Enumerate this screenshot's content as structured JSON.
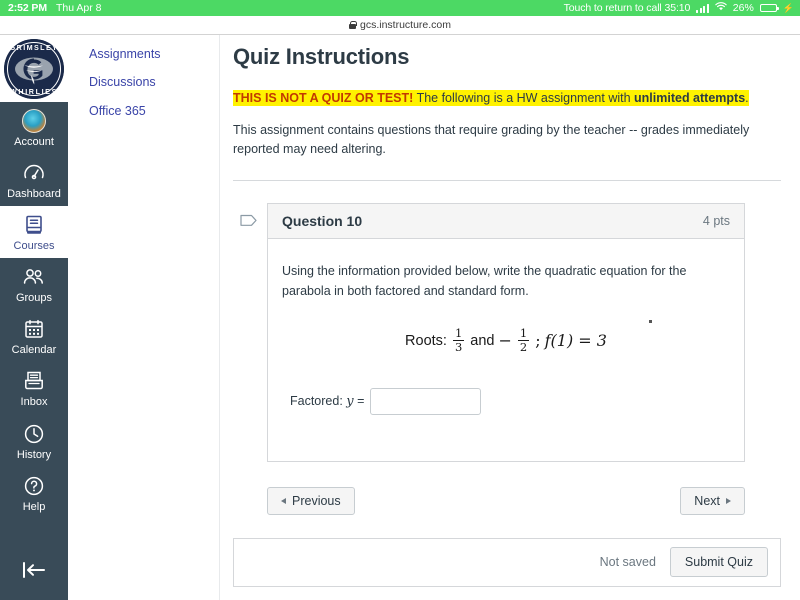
{
  "statusbar": {
    "time": "2:52 PM",
    "date": "Thu Apr 8",
    "call_status": "Touch to return to call 35:10",
    "battery_percent": "26%",
    "signal_icon": "cellular-bars-icon",
    "wifi_icon": "wifi-icon",
    "battery_icon": "battery-icon",
    "charging_icon": "charging-bolt-icon",
    "bg_color": "#4cd964"
  },
  "browser": {
    "url": "gcs.instructure.com",
    "lock_icon": "lock-icon"
  },
  "global_nav": {
    "logo": {
      "name": "grimsley-whirlies-logo",
      "top_text": "GRIMSLEY",
      "bottom_text": "WHIRLIES",
      "letter": "G",
      "color": "#1b2a4a"
    },
    "items": [
      {
        "label": "Account",
        "icon": "user-avatar-icon",
        "active": false
      },
      {
        "label": "Dashboard",
        "icon": "dashboard-icon",
        "active": false
      },
      {
        "label": "Courses",
        "icon": "courses-book-icon",
        "active": true
      },
      {
        "label": "Groups",
        "icon": "groups-icon",
        "active": false
      },
      {
        "label": "Calendar",
        "icon": "calendar-icon",
        "active": false
      },
      {
        "label": "Inbox",
        "icon": "inbox-icon",
        "active": false
      },
      {
        "label": "History",
        "icon": "clock-history-icon",
        "active": false
      },
      {
        "label": "Help",
        "icon": "help-question-icon",
        "active": false
      }
    ],
    "collapse_icon": "collapse-left-arrow-icon",
    "bg_color": "#394b58"
  },
  "course_nav": {
    "items": [
      {
        "label": "Assignments"
      },
      {
        "label": "Discussions"
      },
      {
        "label": "Office 365"
      }
    ],
    "link_color": "#3a44a8"
  },
  "main": {
    "title": "Quiz Instructions",
    "notice": {
      "shout": "THIS IS NOT A QUIZ OR TEST!",
      "text_before_bold": " The following is a HW assignment with ",
      "bold": "unlimited attempts",
      "text_after_bold": ".",
      "highlight_color": "#fff200",
      "shout_color": "#c23a00"
    },
    "paragraph": "This assignment contains questions that require grading by the teacher -- grades immediately reported may need altering.",
    "question": {
      "flag_icon": "flag-bookmark-icon",
      "name": "Question 10",
      "points": "4 pts",
      "prompt": "Using the information provided below, write the quadratic equation for the parabola in both factored and standard form.",
      "equation": {
        "label": "Roots:",
        "root1_num": "1",
        "root1_den": "3",
        "conjunction": "and",
        "minus": "−",
        "root2_num": "1",
        "root2_den": "2",
        "separator": ";",
        "function_part": "f(1) = 3"
      },
      "answer": {
        "label": "Factored:",
        "variable": "y",
        "equals": "=",
        "value": "",
        "placeholder": ""
      }
    },
    "nav_buttons": {
      "previous_label": "Previous",
      "previous_icon": "triangle-left-icon",
      "next_label": "Next",
      "next_icon": "triangle-right-icon"
    },
    "submit_bar": {
      "status": "Not saved",
      "submit_label": "Submit Quiz"
    }
  }
}
